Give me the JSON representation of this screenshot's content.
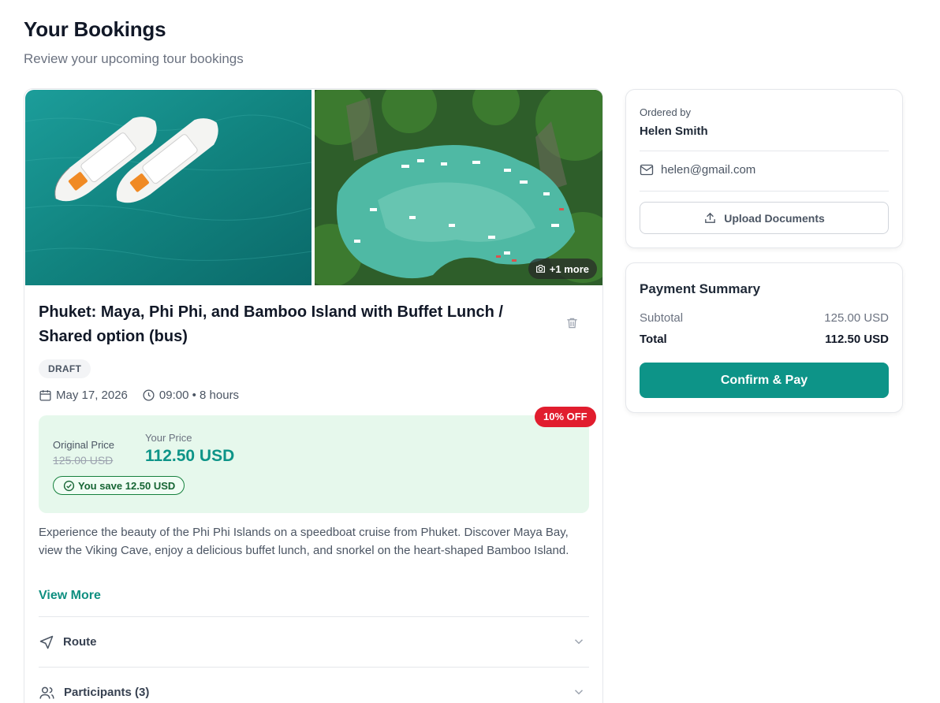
{
  "header": {
    "title": "Your Bookings",
    "subtitle": "Review your upcoming tour bookings"
  },
  "booking": {
    "gallery": {
      "more_label": "+1 more"
    },
    "title": "Phuket: Maya, Phi Phi, and Bamboo Island with Buffet Lunch / Shared option (bus)",
    "status": "DRAFT",
    "date": "May 17, 2026",
    "time_duration": "09:00 • 8 hours",
    "pricing": {
      "discount_badge": "10% OFF",
      "original_label": "Original Price",
      "original_value": "125.00 USD",
      "your_label": "Your Price",
      "your_value": "112.50 USD",
      "savings": "You save 12.50 USD"
    },
    "description": "Experience the beauty of the Phi Phi Islands on a speedboat cruise from Phuket. Discover Maya Bay, view the Viking Cave, enjoy a delicious buffet lunch, and snorkel on the heart-shaped Bamboo Island.",
    "view_more": "View More",
    "sections": [
      {
        "label": "Route",
        "icon": "navigation-icon"
      },
      {
        "label": "Participants (3)",
        "icon": "users-icon"
      }
    ]
  },
  "ordered_by": {
    "label": "Ordered by",
    "name": "Helen Smith",
    "email": "helen@gmail.com",
    "upload_label": "Upload Documents"
  },
  "payment": {
    "title": "Payment Summary",
    "subtotal_label": "Subtotal",
    "subtotal_value": "125.00 USD",
    "total_label": "Total",
    "total_value": "112.50 USD",
    "confirm_label": "Confirm & Pay"
  },
  "colors": {
    "accent": "#0d9488",
    "discount": "#e11d2e",
    "price_bg": "#e6f8ec"
  }
}
